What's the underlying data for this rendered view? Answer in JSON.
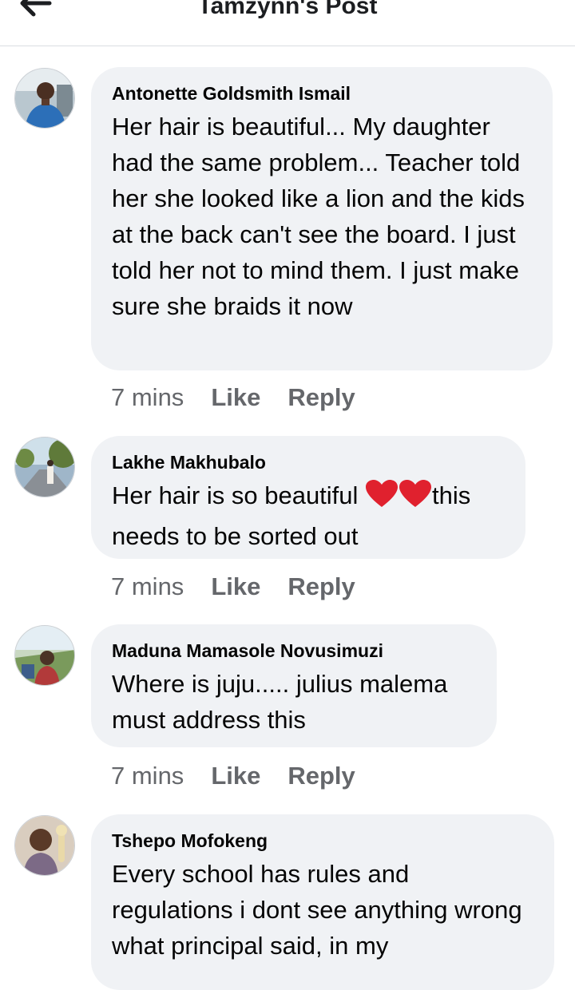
{
  "header": {
    "title": "Tamzynn's Post"
  },
  "comments": [
    {
      "author": "Antonette Goldsmith Ismail",
      "text": "Her hair is beautiful... My daughter had the same problem... Teacher told her she looked like a lion and the kids at the back can't see the board. I just told her not to mind them. I just make sure she braids it now",
      "time": "7 mins",
      "like": "Like",
      "reply": "Reply"
    },
    {
      "author": "Lakhe Makhubalo",
      "text_before": "Her hair is so beautiful ",
      "text_after": "this needs to be sorted out",
      "time": "7 mins",
      "like": "Like",
      "reply": "Reply"
    },
    {
      "author": "Maduna Mamasole Novusimuzi",
      "text": "Where is juju..... julius malema must address this",
      "time": "7 mins",
      "like": "Like",
      "reply": "Reply"
    },
    {
      "author": "Tshepo Mofokeng",
      "text": "Every school has rules and regulations i dont see anything wrong what principal said, in my"
    }
  ],
  "icons": {
    "back": "back-arrow-icon",
    "reaction": "red-heart-icon"
  },
  "colors": {
    "bubble": "#f0f2f5",
    "meta": "#65676b",
    "heart": "#e0212e"
  }
}
